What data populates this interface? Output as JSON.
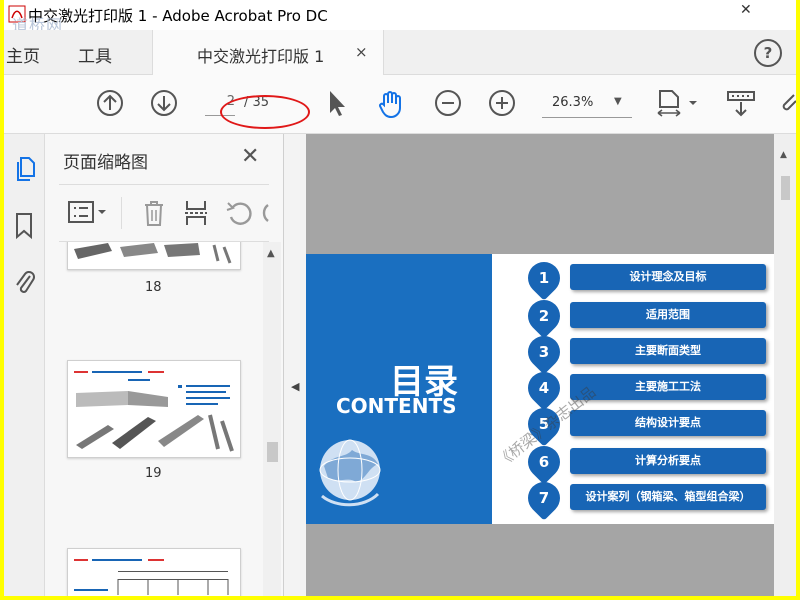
{
  "window": {
    "title": "中交激光打印版 1 - Adobe Acrobat Pro DC",
    "watermark": "道桥网",
    "close_glyph": "✕"
  },
  "tabs": {
    "home": "主页",
    "tools": "工具",
    "document_tab": "中交激光打印版 1",
    "close_glyph": "×",
    "help": "?"
  },
  "toolbar": {
    "page_current": "2",
    "page_total": "/ 35",
    "zoom": "26.3%",
    "accent_color": "#1473e6",
    "annotation_color": "#e01818"
  },
  "thumbnail_panel": {
    "title": "页面缩略图",
    "close": "✕",
    "pages": [
      {
        "label": "18"
      },
      {
        "label": "19"
      },
      {
        "label": ""
      }
    ]
  },
  "document": {
    "title_cn": "目录",
    "title_en": "CONTENTS",
    "watermark": "《桥梁》杂志出品",
    "panel_color": "#1a6fc0",
    "toc": [
      {
        "num": "1",
        "text": "设计理念及目标"
      },
      {
        "num": "2",
        "text": "适用范围"
      },
      {
        "num": "3",
        "text": "主要断面类型"
      },
      {
        "num": "4",
        "text": "主要施工工法"
      },
      {
        "num": "5",
        "text": "结构设计要点"
      },
      {
        "num": "6",
        "text": "计算分析要点"
      },
      {
        "num": "7",
        "text": "设计案列（钢箱梁、箱型组合梁）"
      }
    ]
  }
}
